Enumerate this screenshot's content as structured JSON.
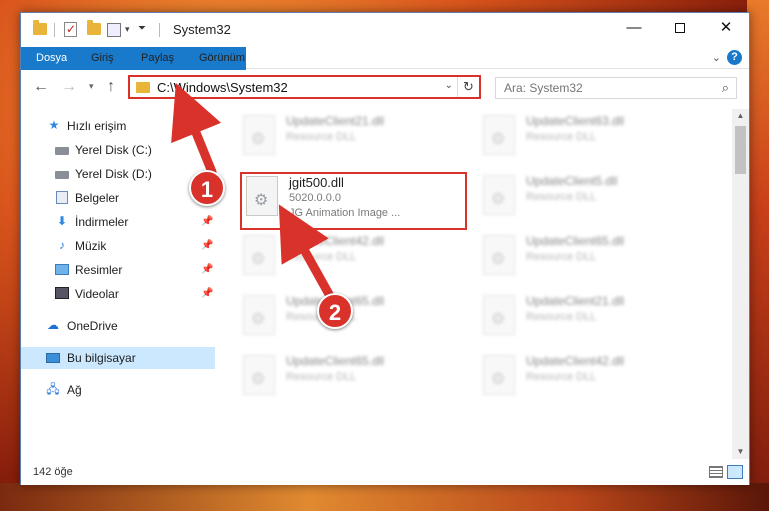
{
  "window": {
    "title": "System32",
    "minimize": "—",
    "close": "✕"
  },
  "ribbon": {
    "tabs": [
      "Dosya",
      "Giriş",
      "Paylaş",
      "Görünüm"
    ],
    "help": "?"
  },
  "address": {
    "path": "C:\\Windows\\System32",
    "refresh": "↻"
  },
  "search": {
    "placeholder": "Ara: System32"
  },
  "sidebar": {
    "items": [
      {
        "label": "Hızlı erişim",
        "icon": "star-icon"
      },
      {
        "label": "Yerel Disk (C:)",
        "icon": "drive-icon"
      },
      {
        "label": "Yerel Disk (D:)",
        "icon": "drive-icon"
      },
      {
        "label": "Belgeler",
        "icon": "documents-icon"
      },
      {
        "label": "İndirmeler",
        "icon": "download-icon"
      },
      {
        "label": "Müzik",
        "icon": "music-icon"
      },
      {
        "label": "Resimler",
        "icon": "pictures-icon"
      },
      {
        "label": "Videolar",
        "icon": "video-icon"
      },
      {
        "label": "OneDrive",
        "icon": "cloud-icon"
      },
      {
        "label": "Bu bilgisayar",
        "icon": "computer-icon"
      },
      {
        "label": "Ağ",
        "icon": "network-icon"
      }
    ]
  },
  "files": [
    {
      "name": "UpdateClient21.dll",
      "type": "Resource DLL"
    },
    {
      "name": "UpdateClient63.dll",
      "type": "Resource DLL"
    },
    {
      "name": "jgit500.dll",
      "version": "5020.0.0.0",
      "description": "JG Animation Image ..."
    },
    {
      "name": "UpdateClient5.dll",
      "type": "Resource DLL"
    },
    {
      "name": "UpdateClient42.dll",
      "type": "Resource DLL"
    },
    {
      "name": "UpdateClient65.dll",
      "type": "Resource DLL"
    },
    {
      "name": "UpdateClient65.dll",
      "type": "Resource DLL"
    },
    {
      "name": "UpdateClient21.dll",
      "type": "Resource DLL"
    },
    {
      "name": "UpdateClient65.dll",
      "type": "Resource DLL"
    },
    {
      "name": "UpdateClient42.dll",
      "type": "Resource DLL"
    }
  ],
  "status": {
    "item_count": "142 öğe"
  },
  "annotations": {
    "step1": "1",
    "step2": "2"
  },
  "colors": {
    "accent": "#1979ca",
    "highlight_border": "#d8322b",
    "selected_bg": "#cce8ff"
  }
}
